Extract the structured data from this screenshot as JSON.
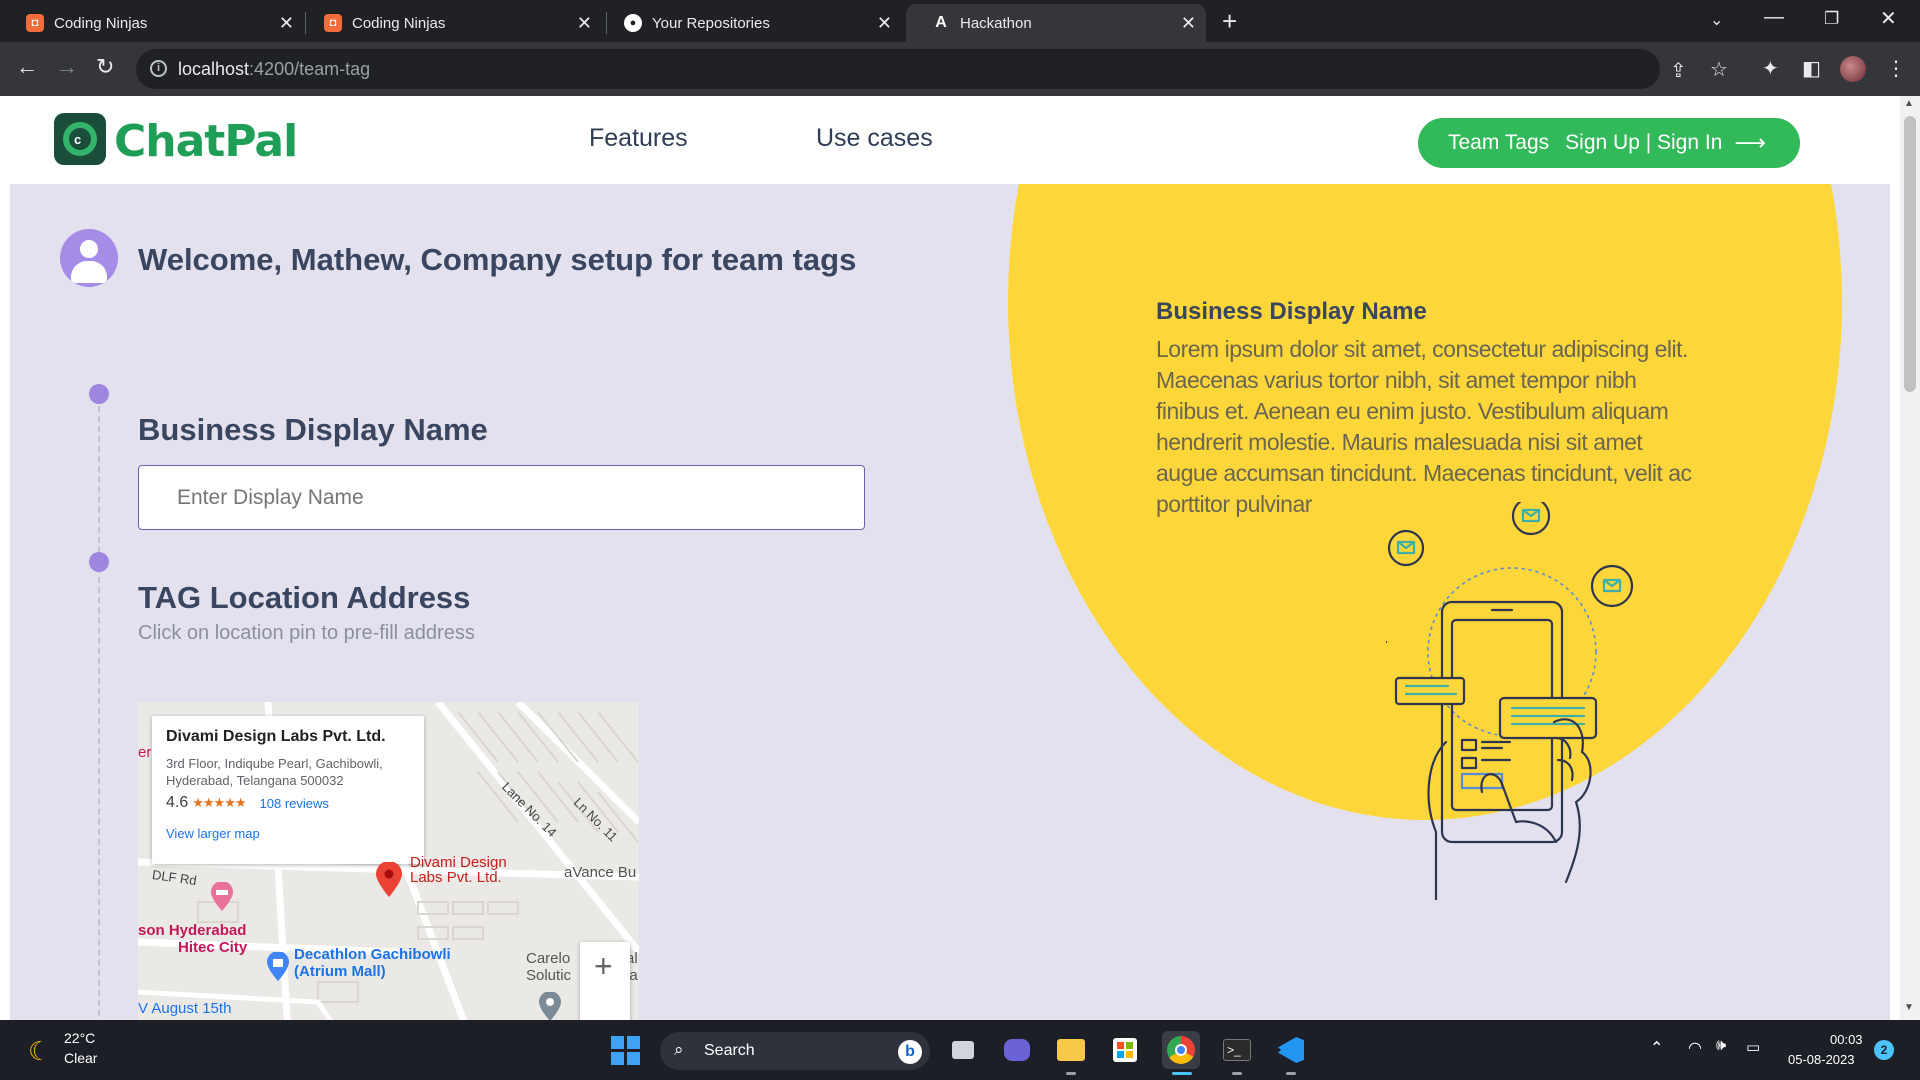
{
  "browser": {
    "tabs": [
      {
        "label": "Coding Ninjas",
        "icon": "coding-ninjas-icon"
      },
      {
        "label": "Coding Ninjas",
        "icon": "coding-ninjas-icon"
      },
      {
        "label": "Your Repositories",
        "icon": "github-icon"
      },
      {
        "label": "Hackathon",
        "icon": "angular-icon",
        "active": true
      }
    ],
    "url_host": "localhost",
    "url_path": ":4200/team-tag"
  },
  "header": {
    "logo_text": "ChatPal",
    "nav": [
      "Features",
      "Use cases"
    ],
    "cta": {
      "team_tags": "Team Tags",
      "auth": "Sign Up | Sign In",
      "arrow": "⟶"
    }
  },
  "welcome": "Welcome, Mathew, Company setup for team tags",
  "form": {
    "display_name": {
      "title": "Business Display Name",
      "placeholder": "Enter Display Name"
    },
    "location": {
      "title": "TAG Location Address",
      "subtitle": "Click on location pin to pre-fill address"
    }
  },
  "map": {
    "place_name": "Divami Design Labs Pvt. Ltd.",
    "address_line1": "3rd Floor, Indiqube Pearl, Gachibowli,",
    "address_line2": "Hyderabad, Telangana 500032",
    "rating": "4.6",
    "stars": "★★★★★",
    "reviews": "108 reviews",
    "larger_map": "View larger map",
    "labels": {
      "pin_label_1": "Divami Design",
      "pin_label_2": "Labs Pvt. Ltd.",
      "lane14": "Lane No. 14",
      "ln11": "Ln No. 11",
      "avance": "aVance Bu",
      "dlf": "DLF Rd",
      "hotel1": "son Hyderabad",
      "hotel2": "Hitec City",
      "decathlon1": "Decathlon Gachibowli",
      "decathlon2": "(Atrium Mall)",
      "carelo1": "Carelo",
      "carelo2": "Solutic",
      "august": "V August 15th",
      "partial_al": "al",
      "partial_ia": "ia",
      "partial_er": "er"
    },
    "zoom_in": "+"
  },
  "info": {
    "title": "Business Display Name",
    "text": "Lorem ipsum dolor sit amet, consectetur adipiscing elit. Maecenas varius tortor nibh, sit amet tempor nibh finibus et. Aenean eu enim justo. Vestibulum aliquam hendrerit molestie. Mauris malesuada nisi sit amet augue accumsan tincidunt. Maecenas tincidunt, velit ac porttitor pulvinar"
  },
  "taskbar": {
    "temperature": "22°C",
    "weather": "Clear",
    "search": "Search",
    "time": "00:03",
    "date": "05-08-2023",
    "notifications": "2"
  },
  "colors": {
    "brand_green": "#31b95a",
    "hero_bg": "#e4e1ef",
    "circle_yellow": "#fdd63a",
    "timeline_dot": "#9e86e0"
  }
}
